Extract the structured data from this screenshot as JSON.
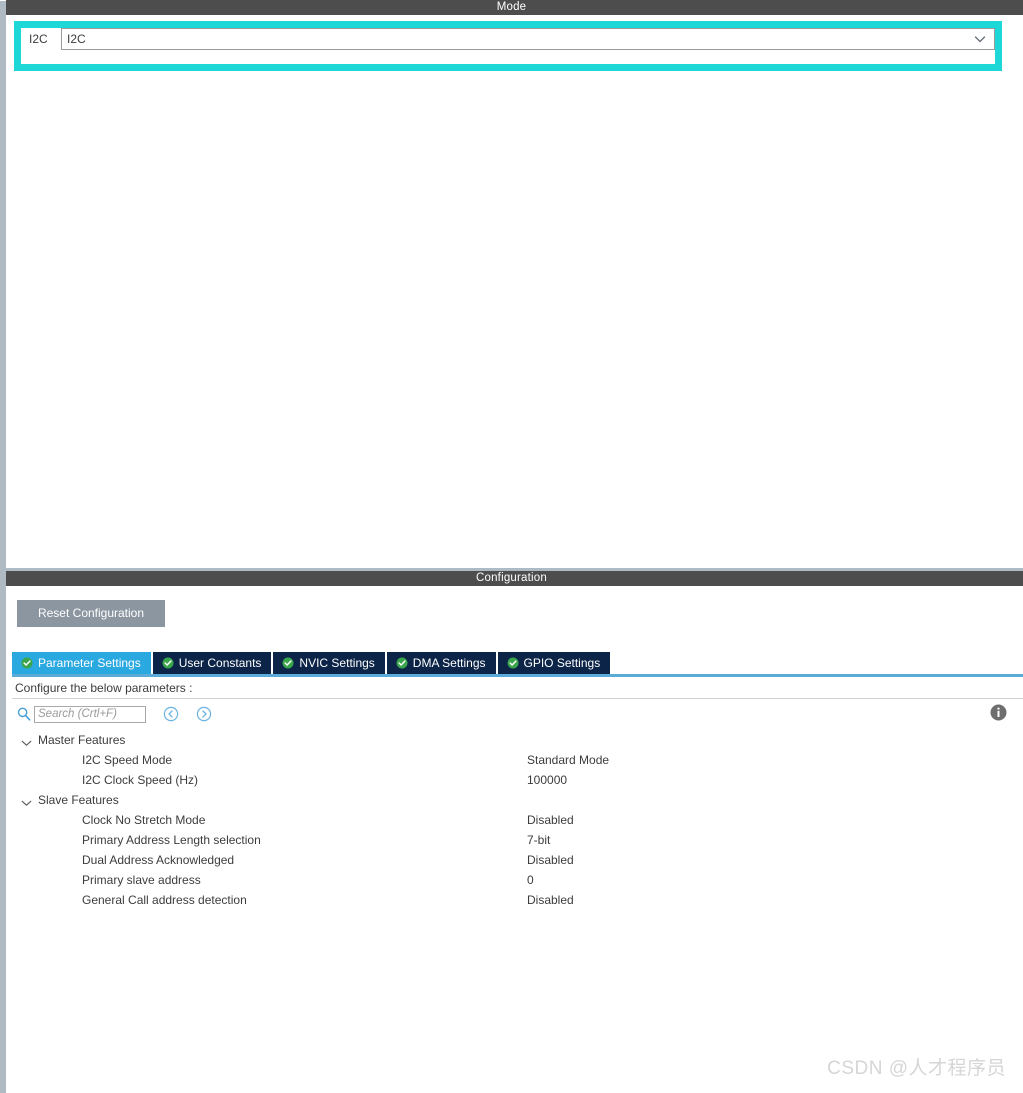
{
  "mode": {
    "header_title": "Mode",
    "peripheral_label": "I2C",
    "selected_value": "I2C",
    "dropdown_arrow_name": "chevron-down-icon"
  },
  "configuration": {
    "header_title": "Configuration",
    "reset_button_label": "Reset Configuration",
    "tabs": [
      {
        "label": "Parameter Settings",
        "active": true
      },
      {
        "label": "User Constants",
        "active": false
      },
      {
        "label": "NVIC Settings",
        "active": false
      },
      {
        "label": "DMA Settings",
        "active": false
      },
      {
        "label": "GPIO Settings",
        "active": false
      }
    ],
    "configure_caption": "Configure the below parameters :",
    "search": {
      "placeholder": "Search (Crtl+F)",
      "value": ""
    },
    "nav": {
      "prev_label": "",
      "next_label": ""
    },
    "groups": [
      {
        "title": "Master Features",
        "expanded": true,
        "params": [
          {
            "name": "I2C Speed Mode",
            "value": "Standard Mode"
          },
          {
            "name": "I2C Clock Speed (Hz)",
            "value": "100000"
          }
        ]
      },
      {
        "title": "Slave Features",
        "expanded": true,
        "params": [
          {
            "name": "Clock No Stretch Mode",
            "value": "Disabled"
          },
          {
            "name": "Primary Address Length selection",
            "value": "7-bit"
          },
          {
            "name": "Dual Address Acknowledged",
            "value": "Disabled"
          },
          {
            "name": "Primary slave address",
            "value": "0"
          },
          {
            "name": "General Call address detection",
            "value": "Disabled"
          }
        ]
      }
    ]
  },
  "watermark": {
    "text": "CSDN @人才程序员"
  },
  "colors": {
    "section_header_bg": "#4d4d4d",
    "highlight_cyan": "#1ed8d8",
    "tab_active_bg": "#2aa8e0",
    "tab_inactive_bg": "#0b2447",
    "tab_underline": "#5babd9",
    "check_green": "#3aa64c",
    "panel_rail": "#b0bac3",
    "button_disabled_bg": "#8c96a0"
  }
}
